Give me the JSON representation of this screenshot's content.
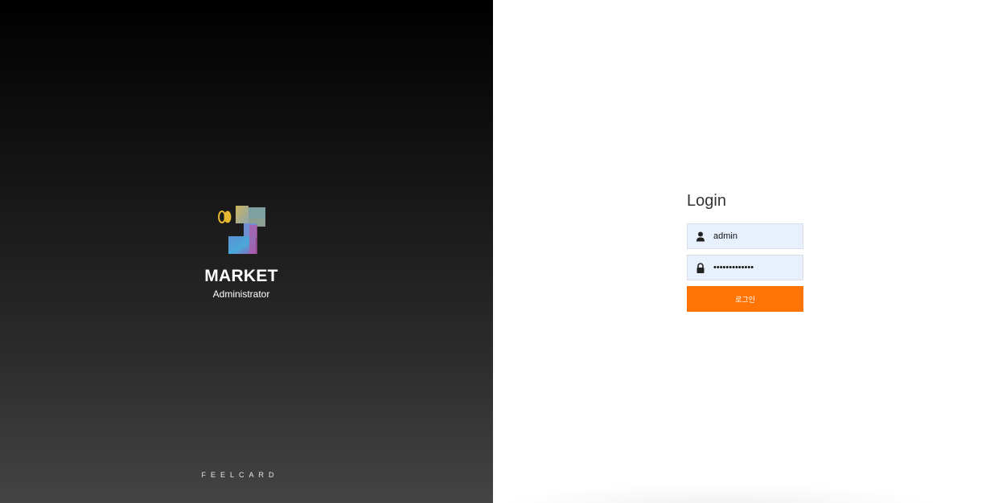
{
  "brand": {
    "title": "MARKET",
    "subtitle": "Administrator",
    "footer": "FEELCARD",
    "logo_icon": "market-logo-icon"
  },
  "login": {
    "title": "Login",
    "username": {
      "value": "admin",
      "icon": "user-icon"
    },
    "password": {
      "value": "adminpassword",
      "icon": "lock-icon"
    },
    "button_label": "로그인"
  },
  "colors": {
    "accent": "#ff7405",
    "input_bg": "#e8f0fe",
    "left_bg_top": "#000000",
    "left_bg_bottom": "#444444"
  }
}
